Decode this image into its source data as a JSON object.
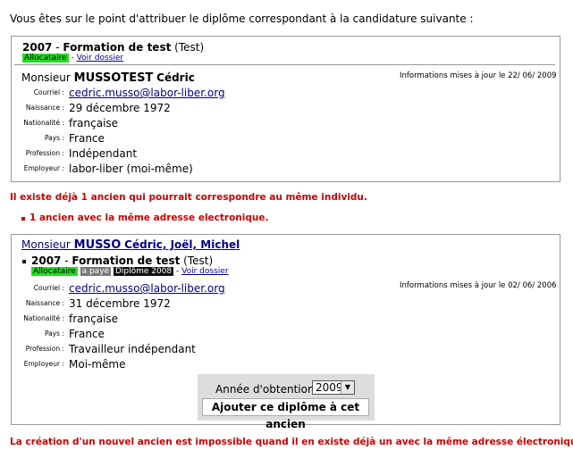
{
  "intro": "Vous êtes sur le point d'attribuer le diplôme correspondant à la candidature suivante :",
  "candidate": {
    "year": "2007",
    "formation": "Formation de test",
    "formation_suffix": "(Test)",
    "badge_allocataire": "Allocataire",
    "voir_dossier": "Voir dossier",
    "civility": "Monsieur",
    "surname": "MUSSOTEST",
    "firstname": "Cédric",
    "updated": "Informations mises à jour le 22/ 06/ 2009",
    "fields": [
      {
        "label": "Courriel :",
        "value": "cedric.musso@labor-liber.org",
        "link": true
      },
      {
        "label": "Naissance :",
        "value": "29 décembre 1972"
      },
      {
        "label": "Nationalité :",
        "value": "française"
      },
      {
        "label": "Pays :",
        "value": "France"
      },
      {
        "label": "Profession :",
        "value": "Indépendant"
      },
      {
        "label": "Employeur :",
        "value": "labor-liber (moi-même)"
      }
    ]
  },
  "warning": "Il existe déjà 1 ancien qui pourrait correspondre au même individu.",
  "reason": "1 ancien avec la même adresse electronique.",
  "match": {
    "civility": "Monsieur",
    "surname": "MUSSO",
    "firstnames": "Cédric, Joël, Michel",
    "year": "2007",
    "formation": "Formation de test",
    "formation_suffix": "(Test)",
    "badge_allocataire": "Allocataire",
    "badge_paye": "a payé",
    "badge_diplome": "Diplôme 2008",
    "voir_dossier": "Voir dossier",
    "updated": "Informations mises à jour le 02/ 06/ 2006",
    "fields": [
      {
        "label": "Courriel :",
        "value": "cedric.musso@labor-liber.org",
        "link": true
      },
      {
        "label": "Naissance :",
        "value": "31 décembre 1972"
      },
      {
        "label": "Nationalité :",
        "value": "française"
      },
      {
        "label": "Pays :",
        "value": "France"
      },
      {
        "label": "Profession :",
        "value": "Travailleur indépendant"
      },
      {
        "label": "Employeur :",
        "value": "Moi-même"
      }
    ],
    "year_label": "Année d'obtention :",
    "year_value": "2009",
    "add_button": "Ajouter ce diplôme à cet ancien"
  },
  "footer_error": "La création d'un nouvel ancien est impossible quand il en existe déjà un avec la même adresse électronique.",
  "colors": {
    "error": "#cc0000",
    "badge_green": "#22dd22",
    "link": "#00008b"
  }
}
